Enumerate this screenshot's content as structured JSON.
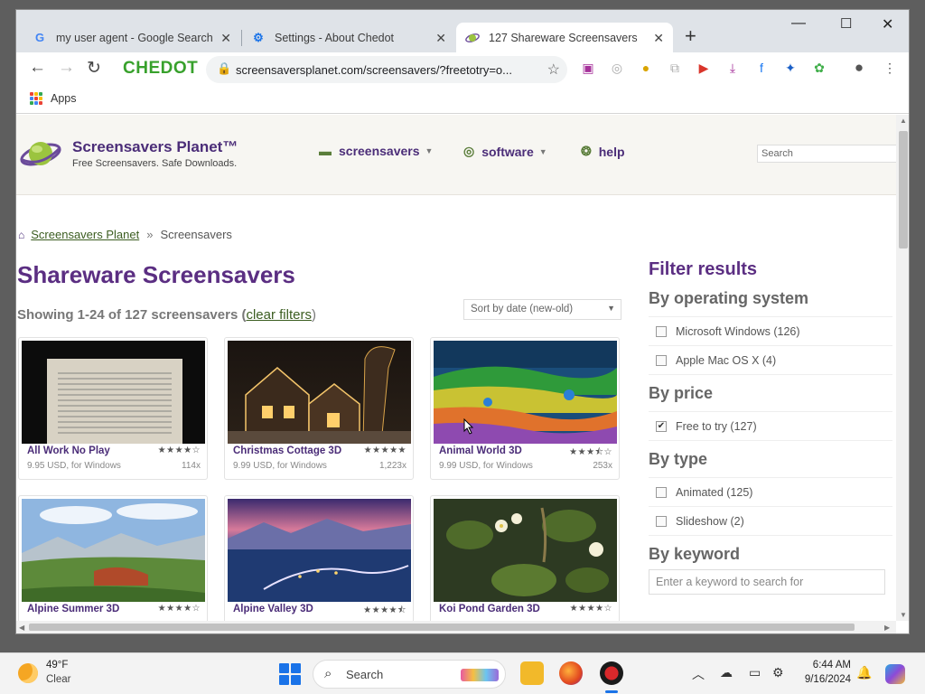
{
  "browser": {
    "tabs": [
      {
        "title": "my user agent - Google Search",
        "icon": "google-icon"
      },
      {
        "title": "Settings - About Chedot",
        "icon": "settings-gear-icon"
      },
      {
        "title": "127 Shareware Screensavers",
        "icon": "planet-icon",
        "active": true
      }
    ],
    "brand": "CHEDOT",
    "url": "screensaversplanet.com/screensavers/?freetotry=o...",
    "bookmarks": {
      "apps_label": "Apps"
    },
    "window_controls": {
      "minimize": "—",
      "maximize": "☐",
      "close": "✕"
    }
  },
  "site": {
    "name": "Screensavers Planet™",
    "tagline": "Free Screensavers. Safe Downloads.",
    "nav": [
      {
        "label": "screensavers",
        "icon": "monitor-icon",
        "dropdown": true
      },
      {
        "label": "software",
        "icon": "disc-icon",
        "dropdown": true
      },
      {
        "label": "help",
        "icon": "lifebuoy-icon",
        "dropdown": false
      }
    ],
    "search_placeholder": "Search"
  },
  "breadcrumb": {
    "home_link": "Screensavers Planet",
    "separator": "»",
    "current": "Screensavers"
  },
  "main": {
    "title": "Shareware Screensavers",
    "showing": "Showing 1-24 of 127 screensavers (",
    "clear_filters": "clear filters",
    "showing_close": ")",
    "sort_label": "Sort by date (new-old)"
  },
  "cards": [
    {
      "name": "All Work No Play",
      "stars": "★★★★☆",
      "price": "9.95 USD, for Windows",
      "downloads": "114x"
    },
    {
      "name": "Christmas Cottage 3D",
      "stars": "★★★★★",
      "price": "9.99 USD, for Windows",
      "downloads": "1,223x"
    },
    {
      "name": "Animal World 3D",
      "stars": "★★★⯪☆",
      "price": "9.99 USD, for Windows",
      "downloads": "253x"
    },
    {
      "name": "Alpine Summer 3D",
      "stars": "★★★★☆",
      "price": "",
      "downloads": ""
    },
    {
      "name": "Alpine Valley 3D",
      "stars": "★★★★⯪",
      "price": "",
      "downloads": ""
    },
    {
      "name": "Koi Pond Garden 3D",
      "stars": "★★★★☆",
      "price": "",
      "downloads": ""
    }
  ],
  "filters": {
    "title": "Filter results",
    "os_heading": "By operating system",
    "os": [
      {
        "label": "Microsoft Windows (126)",
        "checked": false
      },
      {
        "label": "Apple Mac OS X (4)",
        "checked": false
      }
    ],
    "price_heading": "By price",
    "price": [
      {
        "label": "Free to try (127)",
        "checked": true
      }
    ],
    "type_heading": "By type",
    "type": [
      {
        "label": "Animated (125)",
        "checked": false
      },
      {
        "label": "Slideshow (2)",
        "checked": false
      }
    ],
    "keyword_heading": "By keyword",
    "keyword_placeholder": "Enter a keyword to search for"
  },
  "taskbar": {
    "temperature": "49°F",
    "condition": "Clear",
    "search_label": "Search",
    "time": "6:44 AM",
    "date": "9/16/2024"
  },
  "colors": {
    "site_purple": "#5b2e82",
    "link_green": "#3b5d20",
    "chedot_green": "#38a12c"
  }
}
